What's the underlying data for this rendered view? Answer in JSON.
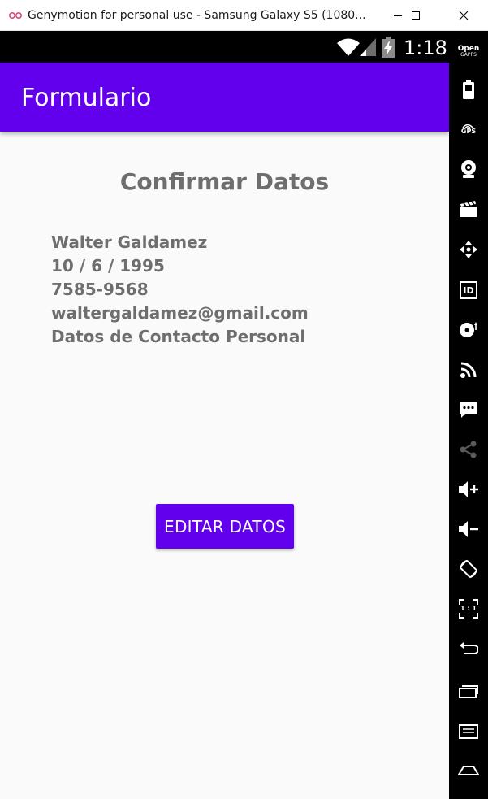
{
  "window": {
    "title": "Genymotion for personal use - Samsung Galaxy S5 (1080...",
    "minimize_icon": "minimize-icon",
    "maximize_icon": "maximize-icon",
    "close_icon": "close-icon"
  },
  "status_bar": {
    "time": "1:18",
    "icons": [
      "wifi-icon",
      "signal-icon",
      "battery-charging-icon"
    ]
  },
  "app_bar": {
    "title": "Formulario",
    "color": "#6200ee"
  },
  "screen": {
    "heading": "Confirmar Datos",
    "details": {
      "name": "Walter Galdamez",
      "birth_date": "10 / 6 / 1995",
      "phone": "7585-9568",
      "email": "waltergaldamez@gmail.com",
      "description": "Datos de Contacto Personal"
    },
    "edit_button_label": "EDITAR DATOS"
  },
  "toolbar": {
    "open_gapps_line1": "Open",
    "open_gapps_line2": "GAPPS",
    "gps_label": "GPS",
    "id_label": "ID",
    "pixel_ratio_label": "1 : 1",
    "items": [
      "open-gapps",
      "battery",
      "gps",
      "webcam",
      "capture",
      "dpad",
      "identifiers",
      "disk-io",
      "cast",
      "sms",
      "share",
      "volume-up",
      "volume-down",
      "rotate",
      "pixel-perfect",
      "back",
      "recent-apps",
      "menu",
      "home"
    ]
  }
}
